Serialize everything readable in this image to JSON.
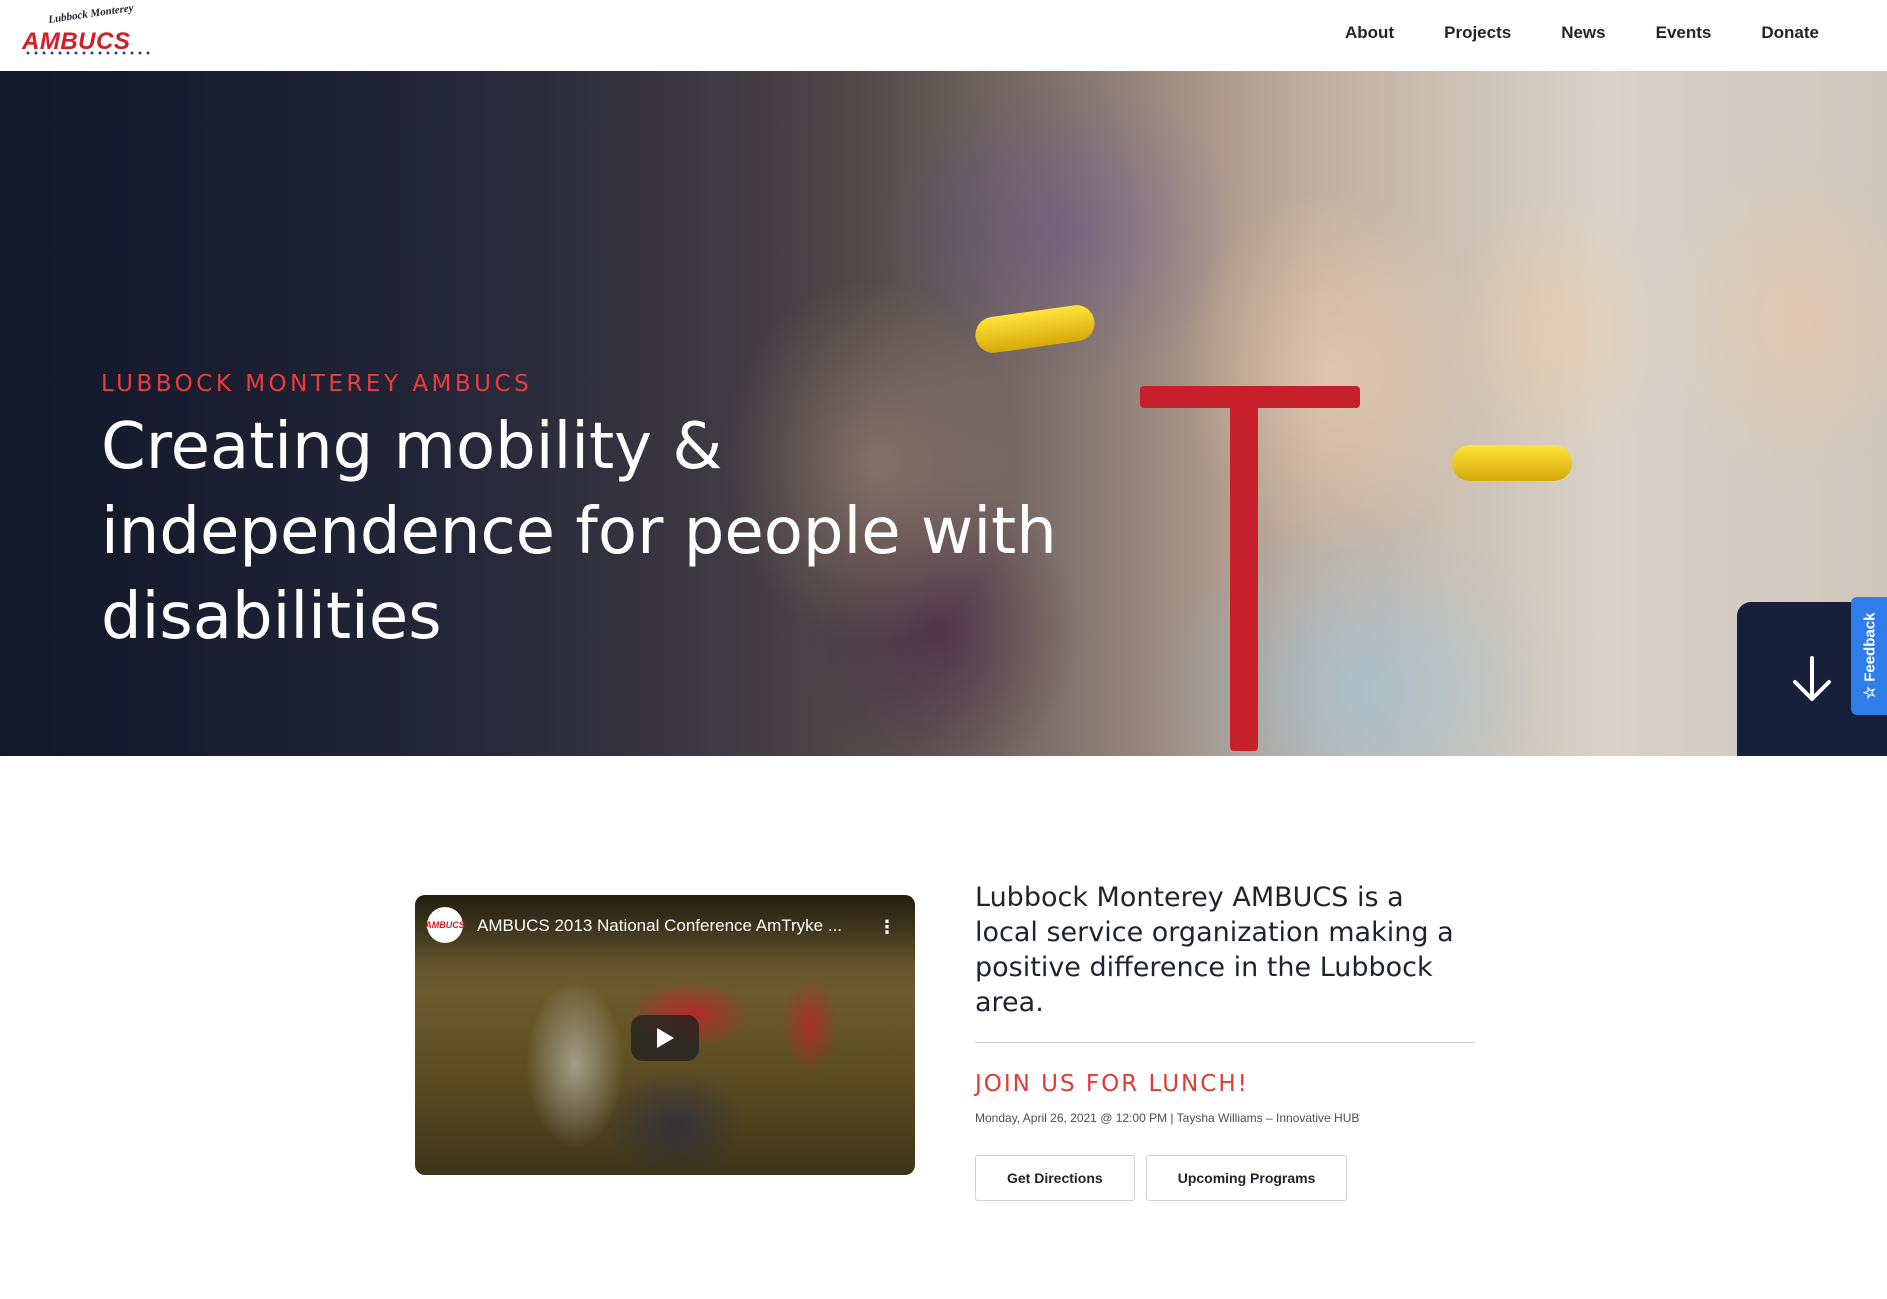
{
  "header": {
    "logo_top": "Lubbock Monterey",
    "logo_main": "AMBUCS",
    "nav": [
      "About",
      "Projects",
      "News",
      "Events",
      "Donate"
    ]
  },
  "hero": {
    "eyebrow": "LUBBOCK MONTEREY AMBUCS",
    "headline": "Creating mobility & independence for people with disabilities",
    "scroll_icon": "arrow-down-icon"
  },
  "feedback": {
    "label": "Feedback",
    "icon": "star-icon"
  },
  "video": {
    "title": "AMBUCS 2013 National Conference AmTryke ...",
    "channel_avatar": "AMBUCS",
    "icons": [
      "channel-avatar",
      "more-vert-icon",
      "play-icon"
    ]
  },
  "about": {
    "text": "Lubbock Monterey AMBUCS is a local service organization making a positive difference in the Lubbock area.",
    "lunch_title": "JOIN US FOR LUNCH!",
    "lunch_meta": "Monday, April 26, 2021 @ 12:00 PM | Taysha Williams – Innovative HUB",
    "buttons": {
      "directions": "Get Directions",
      "programs": "Upcoming Programs"
    }
  },
  "colors": {
    "accent_red": "#e23a34",
    "navy": "#17203a",
    "feedback_blue": "#2f7de8",
    "text": "#1f2330"
  }
}
